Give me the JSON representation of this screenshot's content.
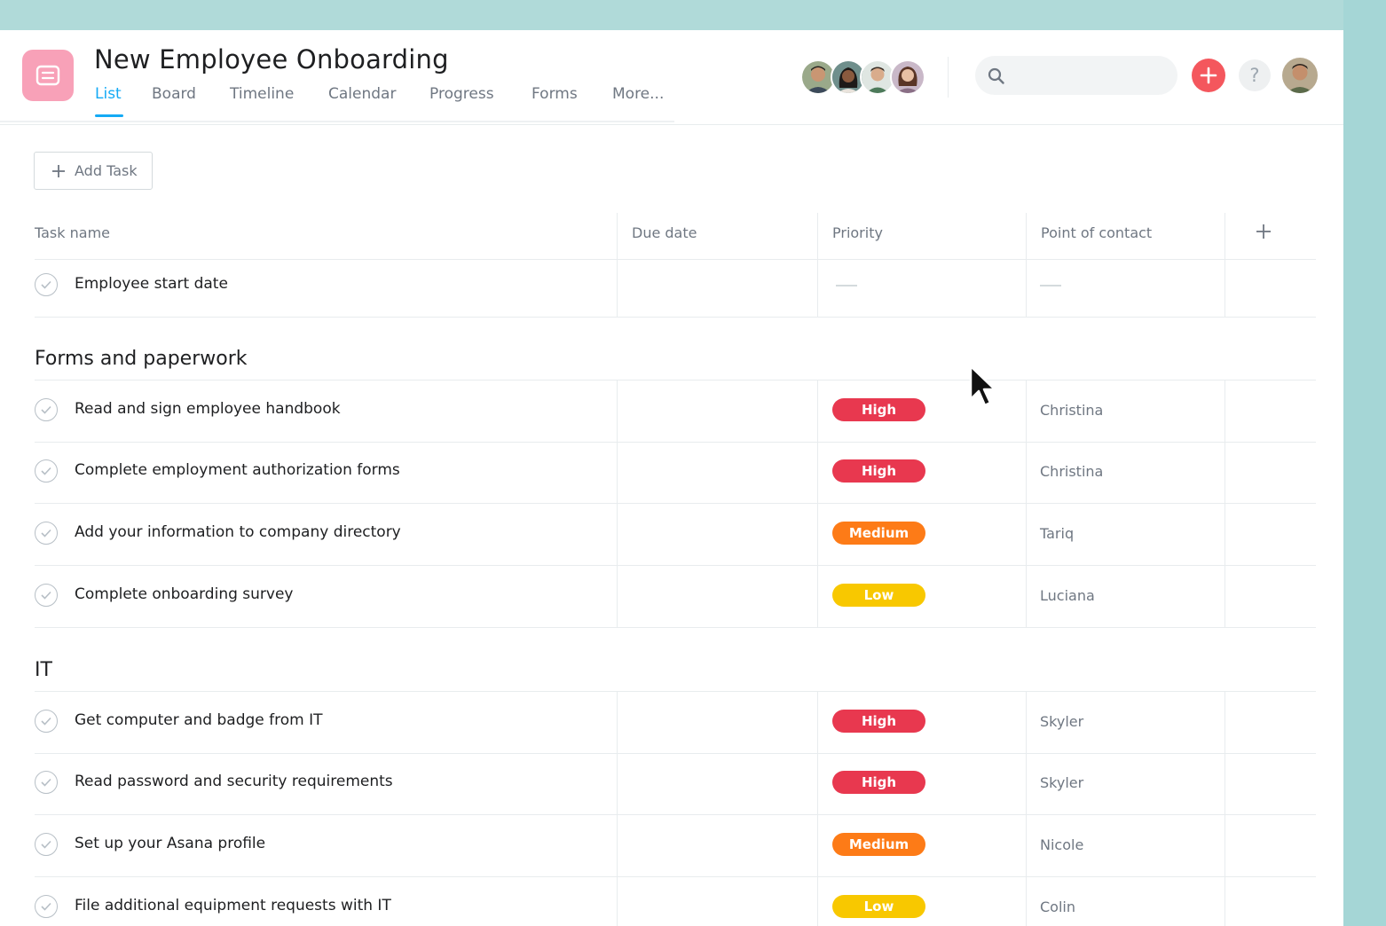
{
  "project": {
    "title": "New Employee Onboarding",
    "icon": "list-icon",
    "color": "#f8a1b8"
  },
  "tabs": [
    {
      "label": "List",
      "active": true
    },
    {
      "label": "Board"
    },
    {
      "label": "Timeline"
    },
    {
      "label": "Calendar"
    },
    {
      "label": "Progress"
    },
    {
      "label": "Forms"
    },
    {
      "label": "More..."
    }
  ],
  "header": {
    "search_placeholder": "",
    "help_label": "?",
    "members": [
      "member-avatar-1",
      "member-avatar-2",
      "member-avatar-3",
      "member-avatar-4"
    ]
  },
  "toolbar": {
    "add_task_label": "Add Task"
  },
  "columns": {
    "task_name": "Task name",
    "due_date": "Due date",
    "priority": "Priority",
    "point_of_contact": "Point of contact"
  },
  "top_tasks": [
    {
      "name": "Employee start date",
      "due": "",
      "priority": "",
      "contact": ""
    }
  ],
  "sections": [
    {
      "title": "Forms and paperwork",
      "tasks": [
        {
          "name": "Read and sign employee handbook",
          "priority": "High",
          "level": "high",
          "contact": "Christina"
        },
        {
          "name": "Complete employment authorization forms",
          "priority": "High",
          "level": "high",
          "contact": "Christina"
        },
        {
          "name": "Add your information to company directory",
          "priority": "Medium",
          "level": "medium",
          "contact": "Tariq"
        },
        {
          "name": "Complete onboarding survey",
          "priority": "Low",
          "level": "low",
          "contact": "Luciana"
        }
      ]
    },
    {
      "title": "IT",
      "tasks": [
        {
          "name": "Get computer and badge from IT",
          "priority": "High",
          "level": "high",
          "contact": "Skyler"
        },
        {
          "name": "Read password and security requirements",
          "priority": "High",
          "level": "high",
          "contact": "Skyler"
        },
        {
          "name": "Set up your Asana profile",
          "priority": "Medium",
          "level": "medium",
          "contact": "Nicole"
        },
        {
          "name": "File additional equipment requests with IT",
          "priority": "Low",
          "level": "low",
          "contact": "Colin"
        }
      ]
    }
  ],
  "colors": {
    "accent": "#14aaf5",
    "high": "#e8384f",
    "medium": "#fd7b17",
    "low": "#f8c800",
    "add_button": "#f4575d",
    "frame": "#a7d8d7"
  }
}
